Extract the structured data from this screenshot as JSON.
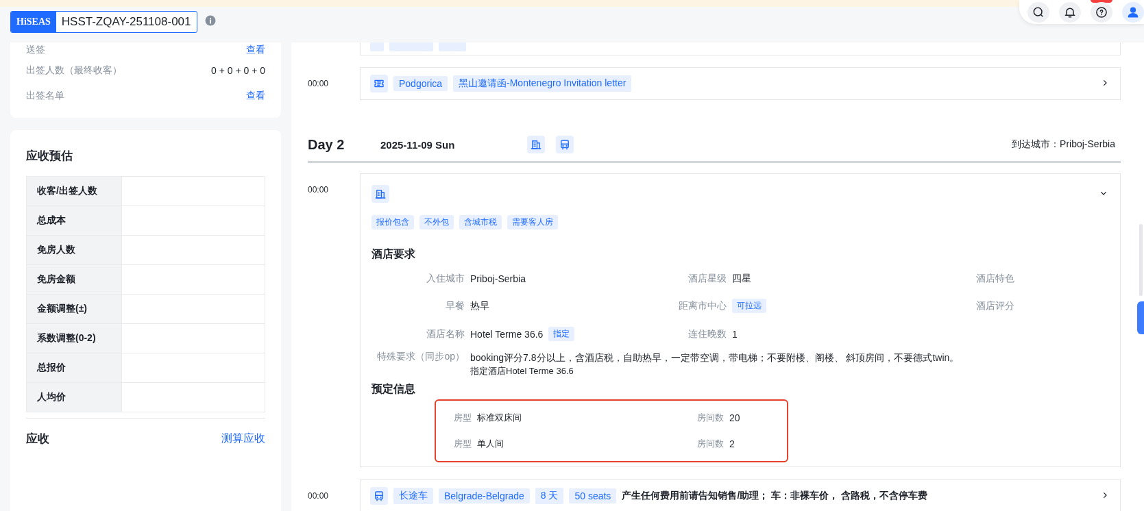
{
  "header": {
    "logo": "HiSEAS",
    "order_no": "HSST-ZQAY-251108-001",
    "notifications_badge": true
  },
  "side": {
    "visa_rows": [
      {
        "label": "送签",
        "value": "查看",
        "kind": "link"
      },
      {
        "label": "出签人数（最终收客）",
        "value": "0 + 0 + 0 + 0",
        "kind": "text"
      },
      {
        "label": "出签名单",
        "value": "查看",
        "kind": "link"
      }
    ],
    "estimate": {
      "title": "应收预估",
      "rows": [
        "收客/出签人数",
        "总成本",
        "免房人数",
        "免房金额",
        "金额调整(±)",
        "系数调整(0-2)",
        "总报价",
        "人均价"
      ]
    },
    "receivable": {
      "title": "应收",
      "action": "测算应收"
    }
  },
  "timeline": {
    "top_items": [
      {
        "time": "00:00",
        "kind": "visa",
        "expanded": false,
        "tags": [
          "Podgorica",
          "黑山邀请函-Montenegro Invitation letter"
        ]
      }
    ],
    "day": {
      "label": "Day 2",
      "date": "2025-11-09 Sun",
      "icons": [
        {
          "kind": "hotel"
        },
        {
          "kind": "bus"
        }
      ],
      "arrival": "到达城市：Priboj-Serbia"
    },
    "hotel": {
      "time": "00:00",
      "expanded": true,
      "tags": [
        "报价包含",
        "不外包",
        "含城市税",
        "需要客人房"
      ],
      "requirements_title": "酒店要求",
      "fields": [
        {
          "label": "入住城市",
          "value": "Priboj-Serbia"
        },
        {
          "label": "酒店星级",
          "value": "四星"
        },
        {
          "label": "酒店特色"
        },
        {
          "label": "早餐",
          "value": "热早"
        },
        {
          "label": "距离市中心",
          "tag": "可拉远"
        },
        {
          "label": "酒店评分"
        },
        {
          "label": "酒店名称",
          "value": "Hotel Terme 36.6",
          "tag": "指定"
        },
        {
          "label": "连住晚数",
          "value": "1"
        }
      ],
      "special": {
        "label": "特殊要求（同步op）",
        "lines": [
          "booking评分7.8分以上，含酒店税，自助热早，一定带空调，带电梯；不要附楼、阁楼、 斜顶房间，不要德式twin。",
          "指定酒店Hotel Terme 36.6"
        ]
      },
      "booking_title": "预定信息",
      "booking_highlighted": true,
      "rooms": [
        {
          "type_label": "房型",
          "type": "标准双床间",
          "count_label": "房间数",
          "count": "20"
        },
        {
          "type_label": "房型",
          "type": "单人间",
          "count_label": "房间数",
          "count": "2"
        }
      ]
    },
    "bottom_items": [
      {
        "time": "00:00",
        "kind": "bus",
        "expanded": false,
        "tags": [
          "长途车",
          "Belgrade-Belgrade",
          "8 天",
          "50 seats"
        ],
        "note": "产生任何费用前请告知销售/助理； 车：非裸车价， 含路税，不含停车费"
      }
    ]
  }
}
